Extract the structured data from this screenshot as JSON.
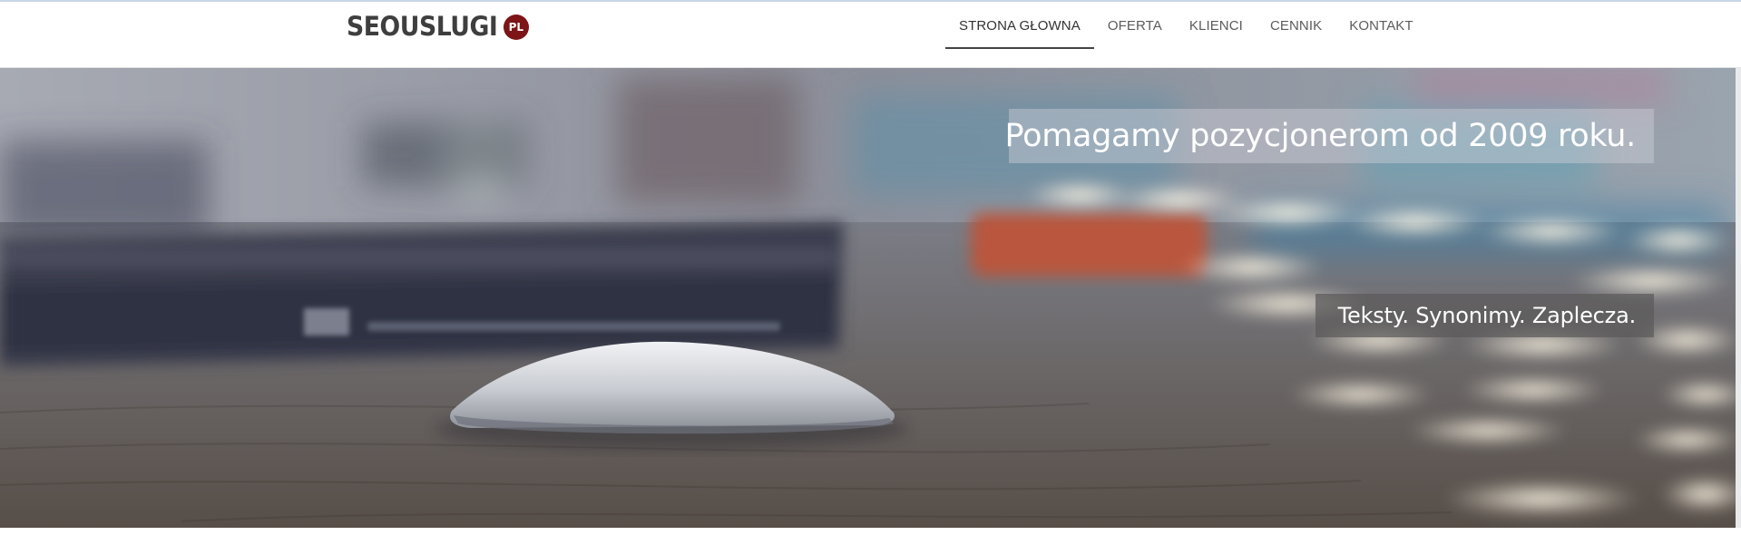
{
  "header": {
    "logo_text": "SEOUSLUGI",
    "logo_badge": "PL",
    "logo_badge_color": "#7d1416"
  },
  "nav": {
    "items": [
      {
        "label": "STRONA GŁOWNA",
        "active": true
      },
      {
        "label": "OFERTA",
        "active": false
      },
      {
        "label": "KLIENCI",
        "active": false
      },
      {
        "label": "CENNIK",
        "active": false
      },
      {
        "label": "KONTAKT",
        "active": false
      }
    ]
  },
  "hero": {
    "image": "blurred desk with laptop and mouse",
    "caption_1": "Pomagamy pozycjonerom od 2009 roku.",
    "caption_2": "Teksty. Synonimy. Zaplecza."
  }
}
